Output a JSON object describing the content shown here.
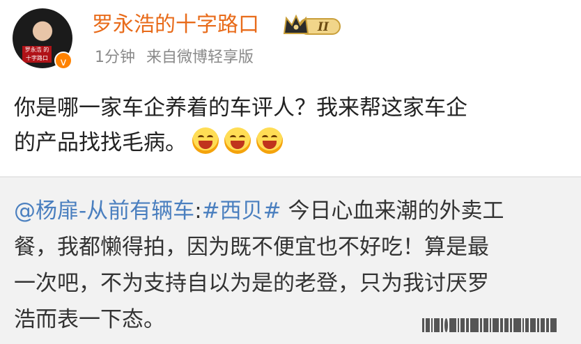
{
  "header": {
    "username": "罗永浩的十字路口",
    "badge_level": "II",
    "verified_symbol": "v",
    "avatar_caption": "罗永浩 的十字路口",
    "time": "1分钟",
    "source": "来自微博轻享版"
  },
  "post": {
    "line1": "你是哪一家车企养着的车评人？我来帮这家车企",
    "line2": "的产品找找毛病。",
    "emojis": [
      "laughing-emoji",
      "laughing-emoji",
      "laughing-emoji"
    ]
  },
  "repost": {
    "mention": "@杨扉-从前有辆车",
    "colon": ":",
    "hashtag": "#西贝#",
    "line1_rest": " 今日心血来潮的外卖工",
    "line2": "餐，我都懒得拍，因为既不便宜也不好吃！算是最",
    "line3": "一次吧，不为支持自以为是的老登，只为我讨厌罗",
    "line4": "浩而表一下态。"
  },
  "colors": {
    "username": "#e86b1a",
    "meta": "#8a8a8a",
    "link": "#4a7fbf",
    "repost_bg": "#f2f2f2",
    "verified": "#ff8200"
  }
}
